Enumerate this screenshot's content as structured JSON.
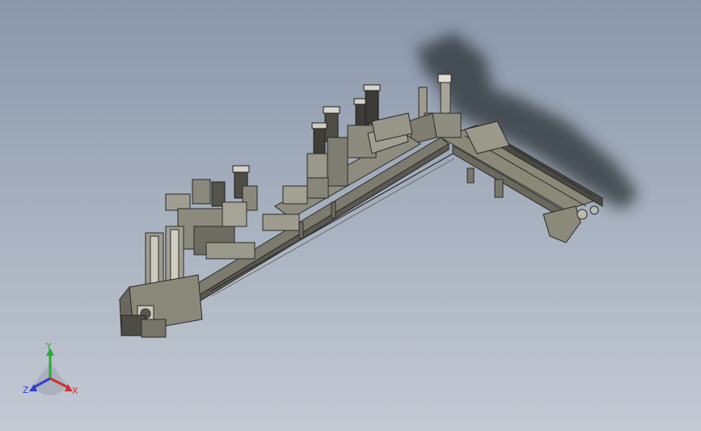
{
  "viewport": {
    "background_top": "#8a97ab",
    "background_bottom": "#c4cad4"
  },
  "triad": {
    "x_label": "X",
    "y_label": "Y",
    "z_label": "Z",
    "x_color": "#d23030",
    "y_color": "#2eaa3c",
    "z_color": "#2f3fd0"
  }
}
